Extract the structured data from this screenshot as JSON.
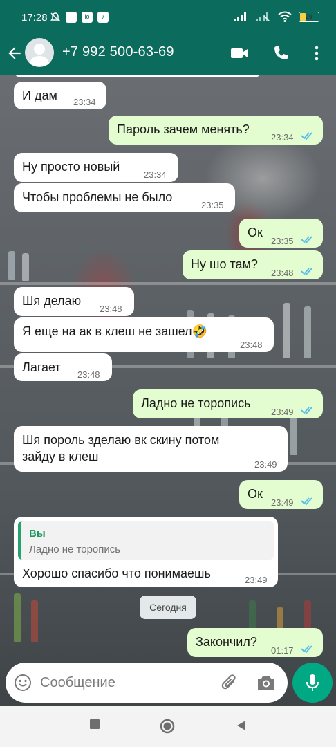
{
  "status_bar": {
    "time": "17:28",
    "carrier_box_1": "lo",
    "carrier_box_2": "♪",
    "battery_level": "29",
    "battery_fraction": 0.29
  },
  "header": {
    "contact_name": "+7 992 500-63-69",
    "icons": [
      "back-arrow-icon",
      "avatar",
      "video-call-icon",
      "voice-call-icon",
      "more-vert-icon"
    ]
  },
  "messages": [
    {
      "dir": "in",
      "text": "И дам",
      "time": "23:34"
    },
    {
      "dir": "out",
      "text": "Пароль зачем менять?",
      "time": "23:34",
      "read": true
    },
    {
      "dir": "in",
      "text": "Ну просто новый",
      "time": "23:34"
    },
    {
      "dir": "in",
      "text": "Чтобы проблемы не было",
      "time": "23:35"
    },
    {
      "dir": "out",
      "text": "Ок",
      "time": "23:35",
      "read": true
    },
    {
      "dir": "out",
      "text": "Ну шо там?",
      "time": "23:48",
      "read": true
    },
    {
      "dir": "in",
      "text": "Шя делаю",
      "time": "23:48"
    },
    {
      "dir": "in",
      "text": "Я еще на ак в клеш не зашел",
      "emoji": "🤣",
      "time": "23:48"
    },
    {
      "dir": "in",
      "text": "Лагает",
      "time": "23:48"
    },
    {
      "dir": "out",
      "text": "Ладно не торопись",
      "time": "23:49",
      "read": true
    },
    {
      "dir": "in",
      "line1": "Шя пороль зделаю вк скину потом",
      "line2": "зайду в клеш",
      "time": "23:49"
    },
    {
      "dir": "out",
      "text": "Ок",
      "time": "23:49",
      "read": true
    },
    {
      "dir": "in",
      "quote_name": "Вы",
      "quote_text": "Ладно не торопись",
      "text": "Хорошо спасибо что понимаешь",
      "time": "23:49"
    },
    {
      "dir": "out",
      "text": "Закончил?",
      "time": "01:17",
      "read": true
    }
  ],
  "date_separator": "Сегодня",
  "composer": {
    "placeholder": "Сообщение",
    "icons": [
      "emoji-icon",
      "attach-icon",
      "camera-icon",
      "mic-icon"
    ]
  },
  "colors": {
    "header": "#0b6b5d",
    "incoming_bubble": "#ffffff",
    "outgoing_bubble": "#e4fdd0",
    "read_ticks": "#53bdeb",
    "mic_button": "#00a884"
  }
}
